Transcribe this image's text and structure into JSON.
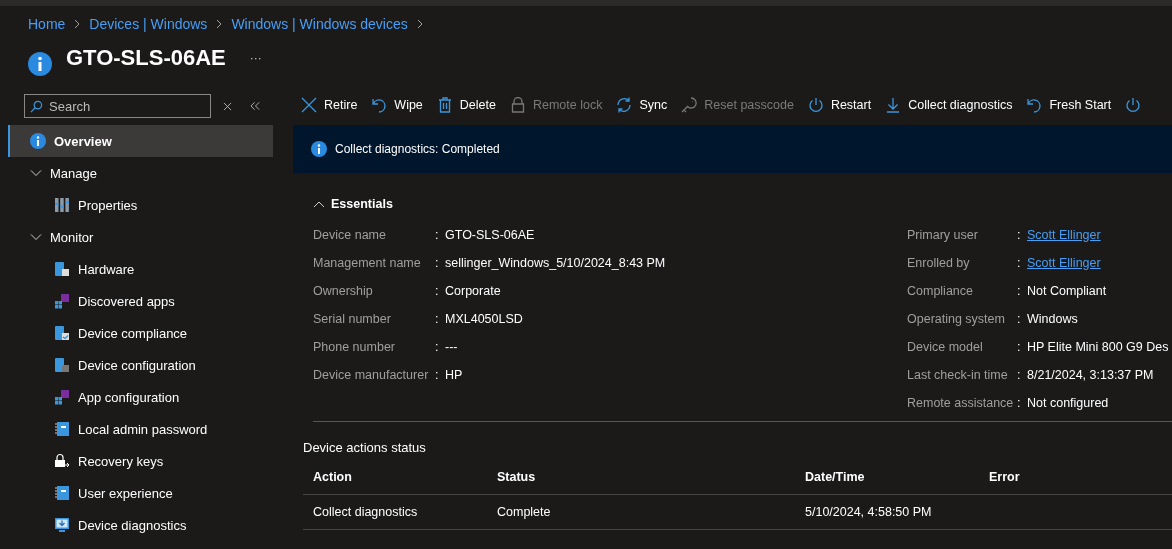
{
  "breadcrumb": [
    "Home",
    "Devices | Windows",
    "Windows | Windows devices"
  ],
  "title": "GTO-SLS-06AE",
  "more": "···",
  "search": {
    "placeholder": "Search"
  },
  "sidebar": {
    "items": [
      {
        "label": "Overview",
        "kind": "info",
        "selected": true
      },
      {
        "label": "Manage",
        "kind": "group",
        "expanded": true,
        "selected": false,
        "children": [
          {
            "label": "Properties",
            "kind": "properties",
            "selected": false
          }
        ]
      },
      {
        "label": "Monitor",
        "kind": "group",
        "expanded": true,
        "selected": false,
        "children": [
          {
            "label": "Hardware",
            "kind": "device",
            "selected": false
          },
          {
            "label": "Discovered apps",
            "kind": "apps",
            "selected": false
          },
          {
            "label": "Device compliance",
            "kind": "compliance",
            "selected": false
          },
          {
            "label": "Device configuration",
            "kind": "config",
            "selected": false
          },
          {
            "label": "App configuration",
            "kind": "apps",
            "selected": false
          },
          {
            "label": "Local admin password",
            "kind": "notebook",
            "selected": false
          },
          {
            "label": "Recovery keys",
            "kind": "lock",
            "selected": false
          },
          {
            "label": "User experience",
            "kind": "notebook",
            "selected": false
          },
          {
            "label": "Device diagnostics",
            "kind": "monitor",
            "selected": false
          }
        ]
      }
    ]
  },
  "toolbar": [
    {
      "label": "Retire",
      "kind": "x",
      "disabled": false
    },
    {
      "label": "Wipe",
      "kind": "undo",
      "disabled": false
    },
    {
      "label": "Delete",
      "kind": "trash",
      "disabled": false
    },
    {
      "label": "Remote lock",
      "kind": "lock",
      "disabled": true
    },
    {
      "label": "Sync",
      "kind": "sync",
      "disabled": false
    },
    {
      "label": "Reset passcode",
      "kind": "key",
      "disabled": true
    },
    {
      "label": "Restart",
      "kind": "power",
      "disabled": false
    },
    {
      "label": "Collect diagnostics",
      "kind": "download",
      "disabled": false
    },
    {
      "label": "Fresh Start",
      "kind": "undo",
      "disabled": false
    },
    {
      "kind": "power",
      "disabled": false
    }
  ],
  "banner": "Collect diagnostics: Completed",
  "essentials": {
    "title": "Essentials",
    "expanded": true,
    "left": [
      {
        "label": "Device name",
        "colon": ":",
        "value": "GTO-SLS-06AE"
      },
      {
        "label": "Management name",
        "colon": ":",
        "value": "sellinger_Windows_5/10/2024_8:43 PM"
      },
      {
        "label": "Ownership",
        "colon": ":",
        "value": "Corporate"
      },
      {
        "label": "Serial number",
        "colon": ":",
        "value": "MXL4050LSD"
      },
      {
        "label": "Phone number",
        "colon": ":",
        "value": "---"
      },
      {
        "label": "Device manufacturer",
        "colon": ":",
        "value": "HP"
      }
    ],
    "right": [
      {
        "label": "Primary user",
        "colon": ":",
        "value": "Scott Ellinger",
        "kind": "link"
      },
      {
        "label": "Enrolled by",
        "colon": ":",
        "value": "Scott Ellinger",
        "kind": "link"
      },
      {
        "label": "Compliance",
        "colon": ":",
        "value": "Not Compliant"
      },
      {
        "label": "Operating system",
        "colon": ":",
        "value": "Windows"
      },
      {
        "label": "Device model",
        "colon": ":",
        "value": "HP Elite Mini 800 G9 Des"
      },
      {
        "label": "Last check-in time",
        "colon": ":",
        "value": "8/21/2024, 3:13:37 PM"
      },
      {
        "label": "Remote assistance",
        "colon": ":",
        "value": "Not configured"
      }
    ]
  },
  "actions_status": {
    "title": "Device actions status",
    "columns": [
      "Action",
      "Status",
      "Date/Time",
      "Error"
    ],
    "rows": [
      [
        "Collect diagnostics",
        "Complete",
        "5/10/2024, 4:58:50 PM"
      ]
    ]
  }
}
